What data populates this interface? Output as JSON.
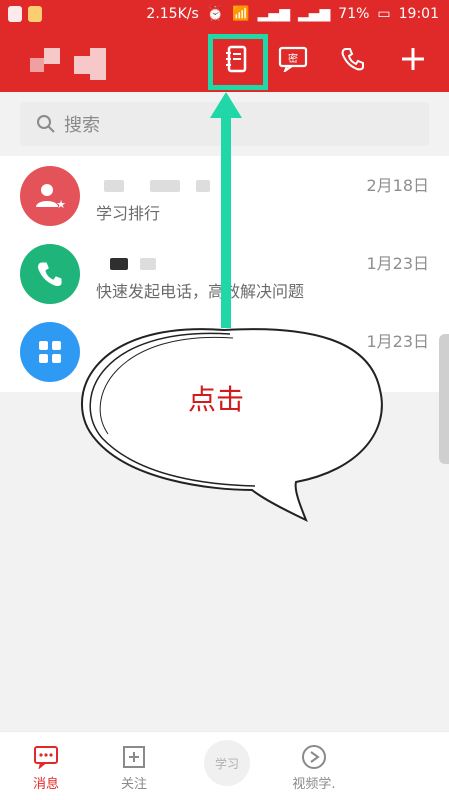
{
  "statusbar": {
    "speed": "2.15K/s",
    "battery": "71%",
    "time": "19:01"
  },
  "search": {
    "placeholder": "搜索"
  },
  "list": {
    "items": [
      {
        "date": "2月18日",
        "subtitle": "学习排行",
        "avatar_color": "#e5535a"
      },
      {
        "date": "1月23日",
        "subtitle": "快速发起电话，高效解决问题",
        "avatar_color": "#1fb57a"
      },
      {
        "date": "1月23日",
        "subtitle": "",
        "avatar_color": "#2f9af3"
      }
    ]
  },
  "annotation": {
    "click_text": "点击",
    "highlight_color": "#20d7a8"
  },
  "tabbar": {
    "tabs": [
      {
        "label": "消息",
        "active": true,
        "icon": "message-icon"
      },
      {
        "label": "关注",
        "active": false,
        "icon": "follow-icon"
      },
      {
        "label": "视频学.",
        "active": false,
        "icon": "play-icon"
      }
    ],
    "center_logo": "学习"
  },
  "colors": {
    "brand_red": "#e02a2a",
    "text_gray": "#8e8e8e"
  }
}
